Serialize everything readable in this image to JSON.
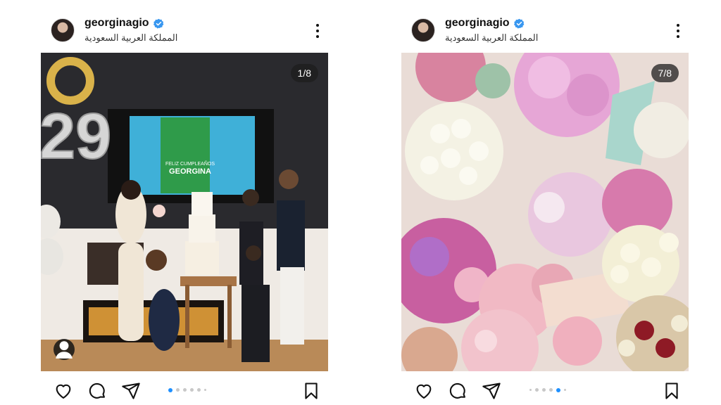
{
  "posts": [
    {
      "username": "georginagio",
      "location": "المملكة العربية السعودية",
      "counter": "1/8",
      "dots_active_index": 0,
      "dots_count": 6,
      "tv_text": {
        "line1": "FELIZ CUMPLEAÑOS",
        "line2": "GEORGINA"
      },
      "balloon_number": "29"
    },
    {
      "username": "georginagio",
      "location": "المملكة العربية السعودية",
      "counter": "7/8",
      "dots_active_index": 4,
      "dots_count": 6
    }
  ],
  "colors": {
    "verified": "#3897f0",
    "dot_active": "#1e90ff",
    "dot_inactive": "#c8c8c8"
  },
  "icons": [
    "heart-icon",
    "comment-icon",
    "share-icon",
    "bookmark-icon",
    "more-icon",
    "verified-icon",
    "tag-user-icon"
  ]
}
